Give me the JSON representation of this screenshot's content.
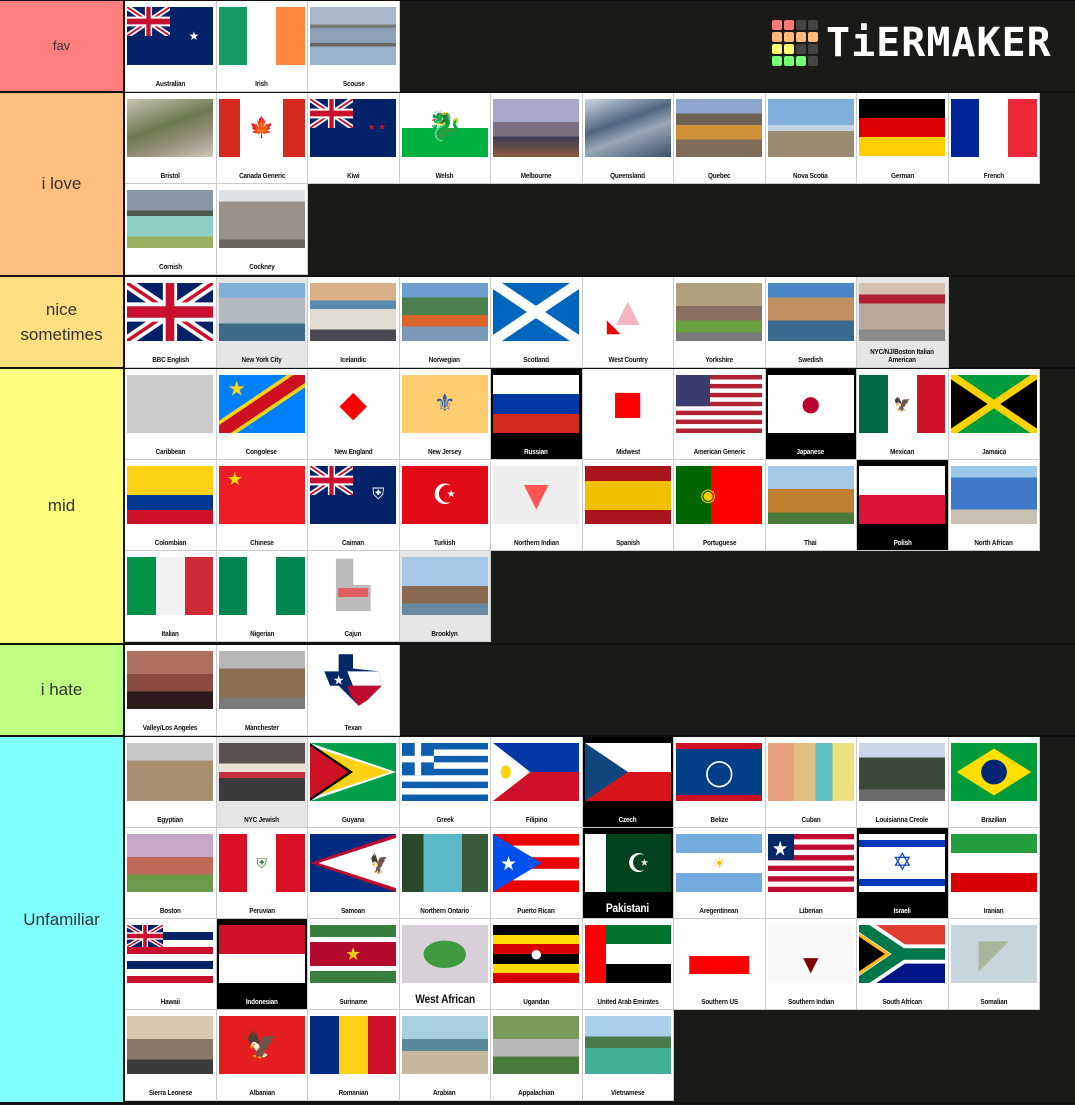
{
  "app": {
    "logo_text": "TiERMAKER",
    "logo_grid": [
      "#f77",
      "#f77",
      "#444",
      "#444",
      "#fb7",
      "#fb7",
      "#fb7",
      "#fb7",
      "#ff7",
      "#ff7",
      "#444",
      "#444",
      "#7f7",
      "#7f7",
      "#7f7",
      "#444"
    ]
  },
  "tiers": [
    {
      "label": "fav",
      "color": "#FF7F7F",
      "small": true,
      "items": [
        {
          "label": "Australian",
          "icon": "flag-australia"
        },
        {
          "label": "Irish",
          "icon": "flag-ireland"
        },
        {
          "label": "Scouse",
          "icon": "photo-liverpool"
        }
      ]
    },
    {
      "label": "i love",
      "color": "#FFBF7F",
      "items": [
        {
          "label": "Bristol",
          "icon": "photo-bristol"
        },
        {
          "label": "Canada Generic",
          "icon": "flag-canada"
        },
        {
          "label": "Kiwi",
          "icon": "flag-new-zealand"
        },
        {
          "label": "Welsh",
          "icon": "flag-wales"
        },
        {
          "label": "Melbourne",
          "icon": "photo-melbourne"
        },
        {
          "label": "Queensland",
          "icon": "photo-queensland"
        },
        {
          "label": "Quebec",
          "icon": "photo-quebec"
        },
        {
          "label": "Nova Scotia",
          "icon": "photo-nova-scotia"
        },
        {
          "label": "German",
          "icon": "flag-germany"
        },
        {
          "label": "French",
          "icon": "flag-france"
        },
        {
          "label": "Cornish",
          "icon": "photo-cornwall"
        },
        {
          "label": "Cockney",
          "icon": "photo-tower-of-london"
        }
      ]
    },
    {
      "label": "nice sometimes",
      "color": "#FFDF7F",
      "items": [
        {
          "label": "BBC English",
          "icon": "flag-uk"
        },
        {
          "label": "New York City",
          "icon": "photo-nyc",
          "bg": "gray"
        },
        {
          "label": "Icelandic",
          "icon": "photo-reykjavik"
        },
        {
          "label": "Norwegian",
          "icon": "photo-bergen"
        },
        {
          "label": "Scotland",
          "icon": "flag-scotland"
        },
        {
          "label": "West Country",
          "icon": "map-west-country"
        },
        {
          "label": "Yorkshire",
          "icon": "photo-york"
        },
        {
          "label": "Swedish",
          "icon": "photo-stockholm"
        },
        {
          "label": "NYC/NJ/Boston Italian American",
          "icon": "photo-pizzeria",
          "bg": "gray",
          "wrap": true
        }
      ]
    },
    {
      "label": "mid",
      "color": "#FFFF7F",
      "items": [
        {
          "label": "Caribbean",
          "icon": "map-caribbean"
        },
        {
          "label": "Congolese",
          "icon": "flag-dr-congo"
        },
        {
          "label": "New England",
          "icon": "map-new-england"
        },
        {
          "label": "New Jersey",
          "icon": "flag-new-jersey"
        },
        {
          "label": "Russian",
          "icon": "flag-russia",
          "bg": "dark"
        },
        {
          "label": "Midwest",
          "icon": "map-midwest"
        },
        {
          "label": "American Generic",
          "icon": "flag-usa"
        },
        {
          "label": "Japanese",
          "icon": "flag-japan",
          "bg": "dark"
        },
        {
          "label": "Mexican",
          "icon": "flag-mexico"
        },
        {
          "label": "Jamaica",
          "icon": "flag-jamaica"
        },
        {
          "label": "Colombian",
          "icon": "flag-colombia"
        },
        {
          "label": "Chinese",
          "icon": "flag-china"
        },
        {
          "label": "Caiman",
          "icon": "flag-cayman-islands"
        },
        {
          "label": "Turkish",
          "icon": "flag-turkey"
        },
        {
          "label": "Northern Indian",
          "icon": "map-northern-india"
        },
        {
          "label": "Spanish",
          "icon": "flag-spain"
        },
        {
          "label": "Portuguese",
          "icon": "flag-portugal"
        },
        {
          "label": "Thai",
          "icon": "photo-thai-temple"
        },
        {
          "label": "Polish",
          "icon": "flag-poland",
          "bg": "dark"
        },
        {
          "label": "North African",
          "icon": "photo-chefchaouen"
        },
        {
          "label": "Italian",
          "icon": "flag-italy"
        },
        {
          "label": "Nigerian",
          "icon": "flag-nigeria"
        },
        {
          "label": "Cajun",
          "icon": "map-louisiana"
        },
        {
          "label": "Brooklyn",
          "icon": "photo-brooklyn-bridge",
          "bg": "gray"
        }
      ]
    },
    {
      "label": "i hate",
      "color": "#BFFF7F",
      "items": [
        {
          "label": "Valley/Los Angeles",
          "icon": "photo-los-angeles"
        },
        {
          "label": "Manchester",
          "icon": "photo-manchester"
        },
        {
          "label": "Texan",
          "icon": "map-texas-flag"
        }
      ]
    },
    {
      "label": "Unfamiliar",
      "color": "#7FFFFF",
      "items": [
        {
          "label": "Egyptian",
          "icon": "photo-cairo"
        },
        {
          "label": "NYC Jewish",
          "icon": "photo-bagel-shop",
          "bg": "gray"
        },
        {
          "label": "Guyana",
          "icon": "flag-guyana"
        },
        {
          "label": "Greek",
          "icon": "flag-greece"
        },
        {
          "label": "Filipino",
          "icon": "flag-philippines"
        },
        {
          "label": "Czech",
          "icon": "flag-czech",
          "bg": "dark"
        },
        {
          "label": "Belize",
          "icon": "flag-belize"
        },
        {
          "label": "Cuban",
          "icon": "photo-havana"
        },
        {
          "label": "Louisianna Creole",
          "icon": "photo-new-orleans"
        },
        {
          "label": "Brazilian",
          "icon": "flag-brazil"
        },
        {
          "label": "Boston",
          "icon": "photo-boston"
        },
        {
          "label": "Peruvian",
          "icon": "flag-peru"
        },
        {
          "label": "Samoan",
          "icon": "flag-american-samoa"
        },
        {
          "label": "Northern Ontario",
          "icon": "photo-ontario-lake"
        },
        {
          "label": "Puerto Rican",
          "icon": "flag-puerto-rico"
        },
        {
          "label": "Pakistani",
          "icon": "flag-pakistan",
          "bg": "dark",
          "big": true
        },
        {
          "label": "Aregentinean",
          "icon": "flag-argentina"
        },
        {
          "label": "Liberian",
          "icon": "flag-liberia"
        },
        {
          "label": "Israeli",
          "icon": "flag-israel",
          "bg": "dark"
        },
        {
          "label": "Iranian",
          "icon": "flag-iran"
        },
        {
          "label": "Hawaii",
          "icon": "flag-hawaii"
        },
        {
          "label": "Indonesian",
          "icon": "flag-indonesia",
          "bg": "dark"
        },
        {
          "label": "Suriname",
          "icon": "flag-suriname"
        },
        {
          "label": "West African",
          "icon": "map-west-africa",
          "big": true
        },
        {
          "label": "Ugandan",
          "icon": "flag-uganda"
        },
        {
          "label": "United Arab Emirates",
          "icon": "flag-uae"
        },
        {
          "label": "Southern US",
          "icon": "map-southern-us"
        },
        {
          "label": "Southern Indian",
          "icon": "map-southern-india"
        },
        {
          "label": "South African",
          "icon": "flag-south-africa"
        },
        {
          "label": "Somalian",
          "icon": "map-somalia"
        },
        {
          "label": "Sierra Leonese",
          "icon": "photo-freetown"
        },
        {
          "label": "Albanian",
          "icon": "flag-albania"
        },
        {
          "label": "Romanian",
          "icon": "flag-romania"
        },
        {
          "label": "Arabian",
          "icon": "photo-riyadh"
        },
        {
          "label": "Appalachian",
          "icon": "photo-appalachia"
        },
        {
          "label": "Vietnamese",
          "icon": "photo-ha-long-bay"
        }
      ]
    }
  ]
}
